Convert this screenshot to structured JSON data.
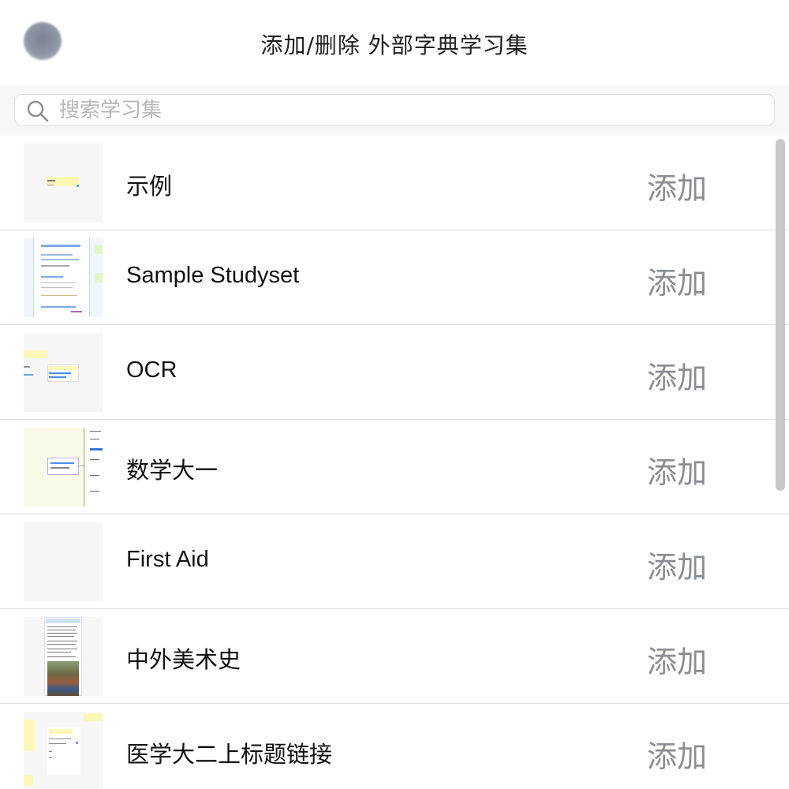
{
  "header": {
    "title": "添加/删除 外部字典学习集",
    "close_icon": "close-dot-icon"
  },
  "search": {
    "placeholder": "搜索学习集",
    "value": "",
    "icon": "search-icon"
  },
  "studysets": [
    {
      "title": "示例",
      "action": "添加",
      "thumbnail": "yellow-note-preview"
    },
    {
      "title": "Sample Studyset",
      "action": "添加",
      "thumbnail": "document-preview-blue-links"
    },
    {
      "title": "OCR",
      "action": "添加",
      "thumbnail": "yellow-note-preview"
    },
    {
      "title": "数学大一",
      "action": "添加",
      "thumbnail": "mindmap-preview"
    },
    {
      "title": "First Aid",
      "action": "添加",
      "thumbnail": "blank-preview"
    },
    {
      "title": "中外美术史",
      "action": "添加",
      "thumbnail": "painting-preview"
    },
    {
      "title": "医学大二上标题链接",
      "action": "添加",
      "thumbnail": "yellow-note-preview"
    }
  ],
  "colors": {
    "action_text": "#8a8d93",
    "divider": "#dedede",
    "search_band": "#f7f7f7"
  }
}
